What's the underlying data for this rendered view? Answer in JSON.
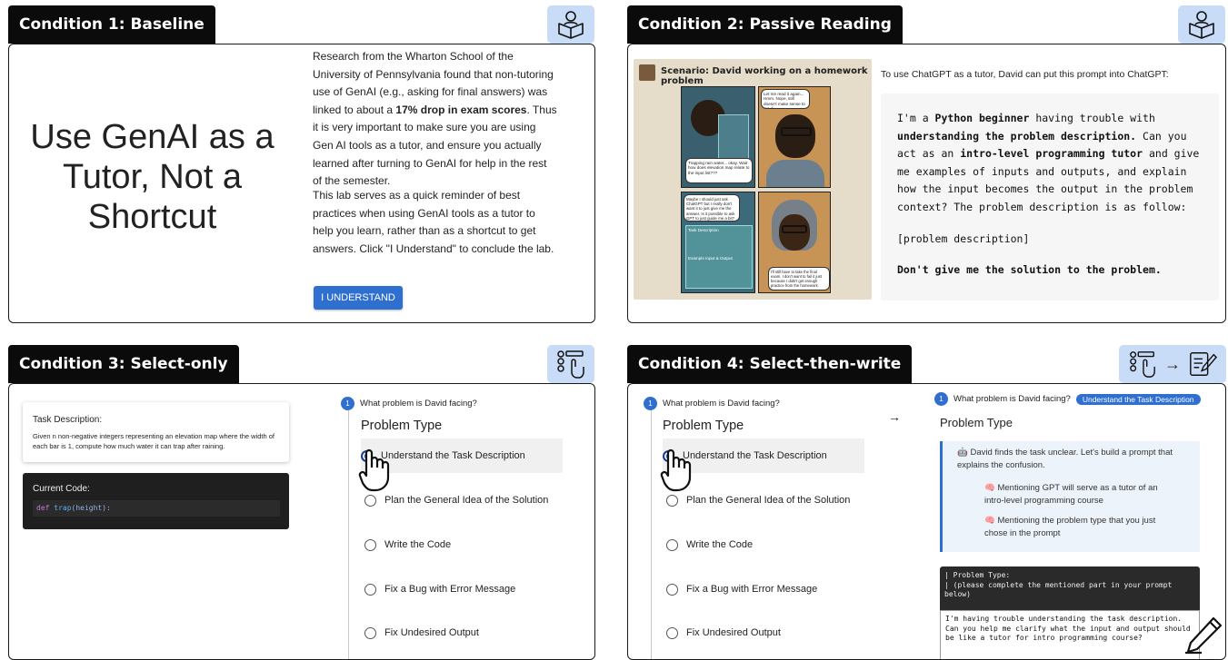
{
  "condition1": {
    "label": "Condition 1: Baseline",
    "icon": "reading-student-icon",
    "title": "Use GenAI as a Tutor, Not a Shortcut",
    "paragraph1_a": "Research from the Wharton School of the University of Pennsylvania found that non-tutoring use of GenAI (e.g., asking for final answers) was linked to about a ",
    "paragraph1_bold": "17% drop in exam scores",
    "paragraph1_b": ". Thus it is very important to make sure you are using Gen AI tools as a tutor, and ensure you actually learned after turning to GenAI for help in the rest of the semester.",
    "paragraph2": "This lab serves as a quick reminder of best practices when using GenAI tools as a tutor to help you learn, rather than as a shortcut to get answers. Click \"I Understand\" to conclude the lab.",
    "button": "I UNDERSTAND"
  },
  "condition2": {
    "label": "Condition 2: Passive Reading",
    "icon": "reading-student-icon",
    "scenario_title": "Scenario: David working on a homework problem",
    "bubble1": "Let me read it again... Hmm. Nope, still doesn't make sense to me :(",
    "bubble2": "Trapping rain water... okay. Wait how does elevation map relate to the input list???",
    "bubble3": "Maybe I should just ask ChatGPT but I really don't want it to just give me the answer. Is it possible to ask GPT to just guide me a bit?",
    "bubble4": "Task Description",
    "bubble5": "Example Input & Output",
    "bubble6": "I'll still have to take the final exam. I don't want to fail it just because I didn't get enough practice from the homework.",
    "intro": "To use ChatGPT as a tutor, David can put this prompt into ChatGPT:",
    "prompt": {
      "t1": "I'm a ",
      "b1": "Python beginner",
      "t2": " having trouble with ",
      "b2": "understanding the problem description.",
      "t3": " Can you act as an ",
      "b3": "intro-level programming tutor",
      "t4": " and give me examples of inputs and outputs, and explain how the input becomes the output in the problem context? The problem description is as follow:",
      "placeholder": "[problem description]",
      "closing": "Don't give me the solution to the problem."
    }
  },
  "condition3": {
    "label": "Condition 3: Select-only",
    "icon": "select-options-icon",
    "task_label": "Task Description:",
    "task_text": "Given n non-negative integers representing an elevation map where the width of each bar is 1, compute how much water it can trap after raining.",
    "code_label": "Current Code:",
    "code_kw": "def ",
    "code_fn": "trap",
    "code_rest": "(height):",
    "question_num": "1",
    "question": "What problem is David facing?",
    "problem_type": "Problem Type",
    "options": [
      "Understand the Task Description",
      "Plan the General Idea of the Solution",
      "Write the Code",
      "Fix a Bug with Error Message",
      "Fix Undesired Output"
    ]
  },
  "condition4": {
    "label": "Condition 4: Select-then-write",
    "icon_left": "select-options-icon",
    "icon_arrow": "→",
    "icon_right": "write-notes-icon",
    "question_num": "1",
    "question": "What problem is David facing?",
    "problem_type": "Problem Type",
    "options": [
      "Understand the Task Description",
      "Plan the General Idea of the Solution",
      "Write the Code",
      "Fix a Bug with Error Message",
      "Fix Undesired Output"
    ],
    "arrow": "→",
    "badge": "Understand the Task Description",
    "hint_intro": "🤖 David finds the task unclear. Let's build a prompt that explains the confusion.",
    "hint_item1": "🧠 Mentioning GPT will serve as a tutor of an intro-level programming course",
    "hint_item2": "🧠 Mentioning the problem type that you just chose in the prompt",
    "editor_header1": "| Problem Type:",
    "editor_header2": "| (please complete the mentioned part in your prompt below)",
    "editor_text": "I'm having trouble understanding the task description. Can you help me clarify what the input and output should be like a tutor for intro programming course?"
  },
  "colors": {
    "accent": "#2f6fd0",
    "icon_bg": "#c9dcf7",
    "tag_bg": "#0b0b0b",
    "code_bg": "#1f1f1f"
  }
}
